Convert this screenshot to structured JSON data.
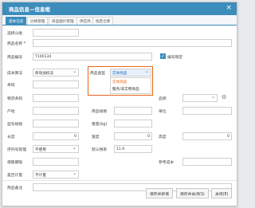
{
  "dialog": {
    "title": "商品信息—信息框",
    "close": "×"
  },
  "tabs": [
    {
      "label": "基本信息"
    },
    {
      "label": "价格管理"
    },
    {
      "label": "商品图片管理"
    },
    {
      "label": "供应商"
    },
    {
      "label": "指定仓库"
    }
  ],
  "form": {
    "category": {
      "label": "选择分类",
      "value": ""
    },
    "name": {
      "label": "商品名称 *",
      "value": ""
    },
    "code": {
      "label": "商品编号",
      "value": "T100134"
    },
    "auto_code": {
      "label": "编号锁定"
    },
    "cost_calc": {
      "label": "成本算法",
      "value": "移动加权法"
    },
    "product_type": {
      "label": "商品类型",
      "value": "实体商品"
    },
    "type_options": [
      "实体商品",
      "服务/非实物商品"
    ],
    "barcode": {
      "label": "条码"
    },
    "unit_alias": {
      "label": "保存日"
    },
    "brand": {
      "label": "品牌"
    },
    "pin": {
      "label": "物流条码"
    },
    "spec_label": {
      "label": "型号规格"
    },
    "origin": {
      "label": "产地"
    },
    "spec_weight": {
      "label": "商品规格"
    },
    "unit": {
      "label": "单位"
    },
    "weight": {
      "label": "重量(kg)"
    },
    "length": {
      "label": "长度",
      "value": "0"
    },
    "width": {
      "label": "宽度",
      "value": "0"
    },
    "height": {
      "label": "高度",
      "value": "0"
    },
    "serial_manage": {
      "label": "序列号管理",
      "value": "不使用"
    },
    "tax_rate": {
      "label": "默认税率",
      "value": "11.9"
    },
    "warehouse": {
      "label": "保质期限"
    },
    "ref_cost": {
      "label": "参考成本"
    },
    "shelf_life": {
      "label": "是否计量",
      "value": "不计量"
    },
    "remark": {
      "label": "商品备注",
      "value": ""
    }
  },
  "buttons": {
    "save_new": "保存并新增",
    "save_close": "保存并关闭(S)",
    "close": "关闭(E)"
  }
}
